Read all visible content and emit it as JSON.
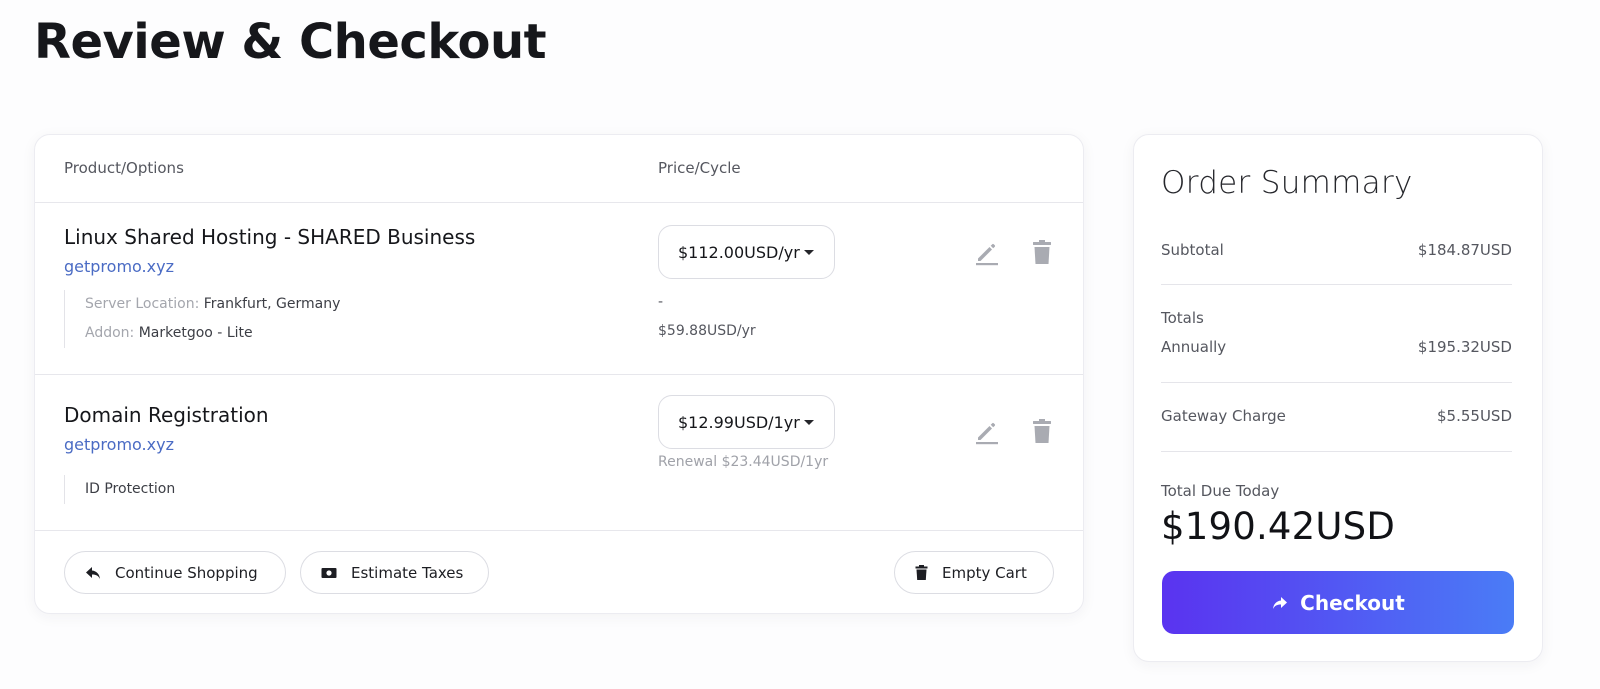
{
  "page": {
    "title": "Review & Checkout"
  },
  "cart": {
    "headers": {
      "product": "Product/Options",
      "price": "Price/Cycle"
    },
    "items": [
      {
        "name": "Linux Shared Hosting - SHARED Business",
        "domain": "getpromo.xyz",
        "price": "$112.00USD/yr",
        "options": [
          {
            "key": "Server Location:",
            "value": "Frankfurt, Germany",
            "price": "-"
          },
          {
            "key": "Addon:",
            "value": "Marketgoo - Lite",
            "price": "$59.88USD/yr"
          }
        ],
        "edit_icon": "pencil-icon",
        "delete_icon": "trash-icon"
      },
      {
        "name": "Domain Registration",
        "domain": "getpromo.xyz",
        "price": "$12.99USD/1yr",
        "renewal": "Renewal $23.44USD/1yr",
        "options": [
          {
            "value": "ID Protection"
          }
        ],
        "edit_icon": "pencil-icon",
        "delete_icon": "trash-icon"
      }
    ],
    "actions": {
      "continue_shopping": "Continue Shopping",
      "estimate_taxes": "Estimate Taxes",
      "empty_cart": "Empty Cart"
    }
  },
  "summary": {
    "title": "Order Summary",
    "subtotal_label": "Subtotal",
    "subtotal_value": "$184.87USD",
    "totals_label": "Totals",
    "annually_label": "Annually",
    "annually_value": "$195.32USD",
    "gateway_label": "Gateway Charge",
    "gateway_value": "$5.55USD",
    "due_label": "Total Due Today",
    "due_amount": "$190.42USD",
    "checkout_label": "Checkout"
  },
  "colors": {
    "link": "#4a6bc4",
    "checkout_gradient_start": "#5a33f0",
    "checkout_gradient_end": "#4a7cf6",
    "icon_gray": "#a9abb2"
  }
}
